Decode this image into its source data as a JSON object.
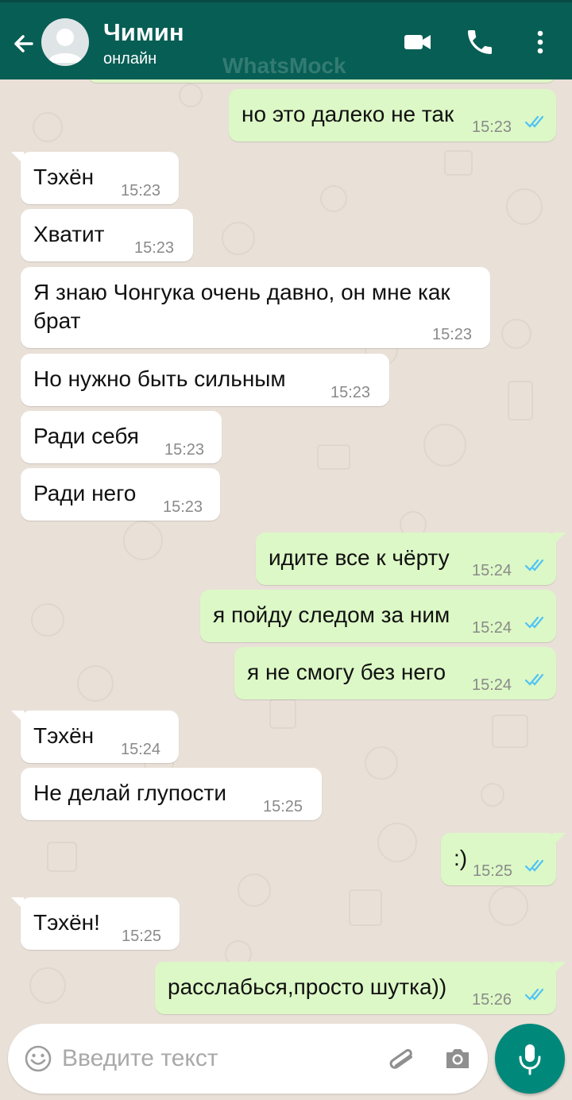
{
  "header": {
    "contact_name": "Чимин",
    "status": "онлайн",
    "watermark": "WhatsMock"
  },
  "icons": {
    "back": "arrow-left-icon",
    "avatar": "default-avatar",
    "video": "video-camera-icon",
    "call": "phone-icon",
    "more": "more-vertical-icon",
    "emoji": "emoji-icon",
    "attach": "paperclip-icon",
    "camera": "camera-icon",
    "mic": "microphone-icon",
    "read": "double-check-icon"
  },
  "colors": {
    "header": "#075e54",
    "outgoing_bubble": "#dcf8c6",
    "incoming_bubble": "#ffffff",
    "read_ticks": "#4fc3f7",
    "mic_button": "#00897b",
    "chat_background": "#e9e1d8"
  },
  "messages": [
    {
      "dir": "out",
      "text": "но это далеко не так",
      "time": "15:23"
    },
    {
      "dir": "in",
      "text": "Тэхён",
      "time": "15:23"
    },
    {
      "dir": "in",
      "text": "Хватит",
      "time": "15:23"
    },
    {
      "dir": "in",
      "text": "Я знаю Чонгука очень давно, он мне как брат",
      "time": "15:23"
    },
    {
      "dir": "in",
      "text": "Но нужно быть сильным",
      "time": "15:23"
    },
    {
      "dir": "in",
      "text": "Ради себя",
      "time": "15:23"
    },
    {
      "dir": "in",
      "text": "Ради него",
      "time": "15:23"
    },
    {
      "dir": "out",
      "text": "идите все к чёрту",
      "time": "15:24"
    },
    {
      "dir": "out",
      "text": "я пойду следом за ним",
      "time": "15:24"
    },
    {
      "dir": "out",
      "text": "я не смогу без него",
      "time": "15:24"
    },
    {
      "dir": "in",
      "text": "Тэхён",
      "time": "15:24"
    },
    {
      "dir": "in",
      "text": "Не делай глупости",
      "time": "15:25"
    },
    {
      "dir": "out",
      "text": ":)",
      "time": "15:25"
    },
    {
      "dir": "in",
      "text": "Тэхён!",
      "time": "15:25"
    },
    {
      "dir": "out",
      "text": "расслабься,просто шутка))",
      "time": "15:26"
    }
  ],
  "composer": {
    "placeholder": "Введите текст"
  }
}
